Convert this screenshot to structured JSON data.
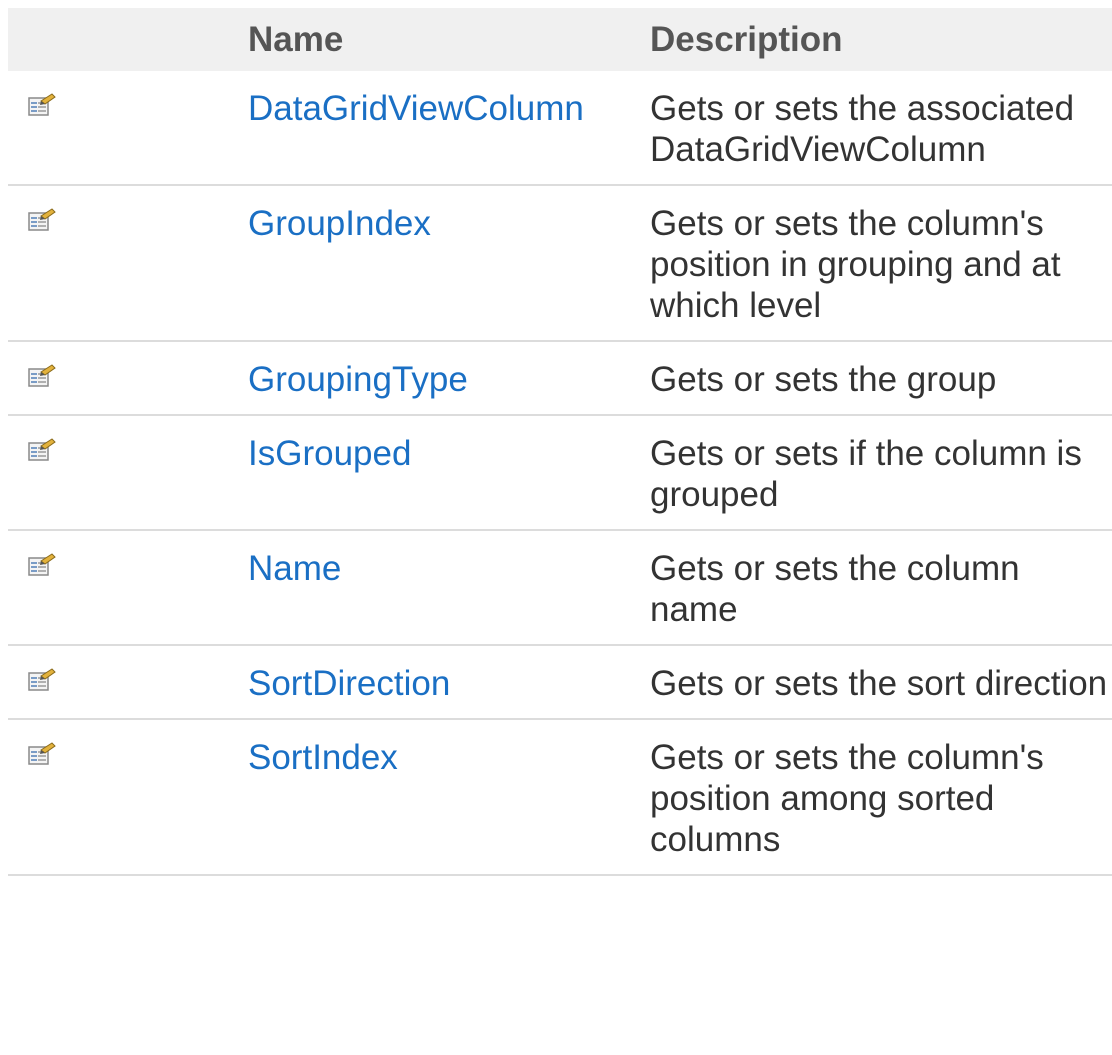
{
  "table": {
    "headers": {
      "icon": "",
      "name": "Name",
      "description": "Description"
    },
    "rows": [
      {
        "icon": "property-icon",
        "name": "DataGridViewColumn",
        "description": "Gets or sets the associated DataGridViewColumn"
      },
      {
        "icon": "property-icon",
        "name": "GroupIndex",
        "description": "Gets or sets the column's position in grouping and at which level"
      },
      {
        "icon": "property-icon",
        "name": "GroupingType",
        "description": "Gets or sets the group"
      },
      {
        "icon": "property-icon",
        "name": "IsGrouped",
        "description": "Gets or sets if the column is grouped"
      },
      {
        "icon": "property-icon",
        "name": "Name",
        "description": "Gets or sets the column name"
      },
      {
        "icon": "property-icon",
        "name": "SortDirection",
        "description": "Gets or sets the sort direction"
      },
      {
        "icon": "property-icon",
        "name": "SortIndex",
        "description": "Gets or sets the column's position among sorted columns"
      }
    ]
  },
  "colors": {
    "link": "#1a6fc4",
    "header_bg": "#f0f0f0",
    "header_text": "#555555",
    "body_text": "#333333",
    "row_divider": "#dcdcdc"
  }
}
